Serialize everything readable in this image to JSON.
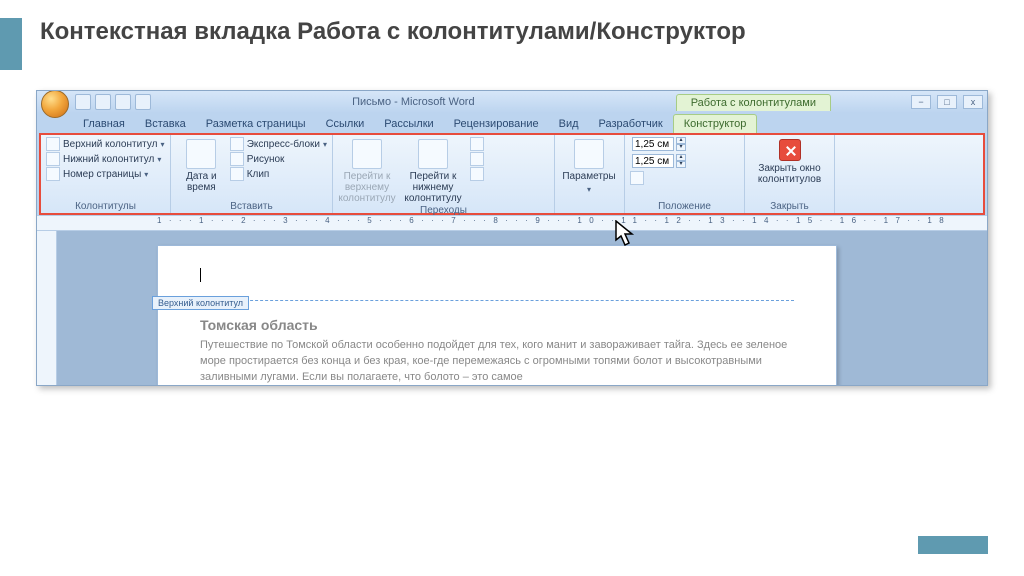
{
  "slide": {
    "title": "Контекстная вкладка Работа с колонтитулами/Конструктор"
  },
  "window": {
    "title": "Письмо - Microsoft Word",
    "context_title": "Работа с колонтитулами",
    "controls": {
      "min": "−",
      "max": "□",
      "close": "x"
    }
  },
  "tabs": {
    "items": [
      "Главная",
      "Вставка",
      "Разметка страницы",
      "Ссылки",
      "Рассылки",
      "Рецензирование",
      "Вид",
      "Разработчик"
    ],
    "active": "Конструктор"
  },
  "ribbon": {
    "group_kolont": {
      "label": "Колонтитулы",
      "top": "Верхний колонтитул",
      "mid": "Нижний колонтитул",
      "bot": "Номер страницы"
    },
    "group_insert": {
      "label": "Вставить",
      "date": "Дата и время",
      "express": "Экспресс-блоки",
      "pic": "Рисунок",
      "clip": "Клип"
    },
    "group_nav": {
      "label": "Переходы",
      "prev": "Перейти к верхнему колонтитулу",
      "next": "Перейти к нижнему колонтитулу"
    },
    "group_params": {
      "label": "",
      "btn": "Параметры"
    },
    "group_pos": {
      "label": "Положение",
      "top_val": "1,25 см",
      "bot_val": "1,25 см"
    },
    "group_close": {
      "label": "Закрыть",
      "btn": "Закрыть окно колонтитулов"
    }
  },
  "ruler": "1···1···2···3···4···5···6···7···8···9···10··11··12··13··14··15··16··17··18",
  "document": {
    "header_tag": "Верхний колонтитул",
    "heading": "Томская область",
    "body": "Путешествие по Томской области особенно подойдет для тех, кого манит и завораживает тайга. Здесь ее зеленое море простирается без конца и без края, кое-где перемежаясь с огромными топями болот и высокотравными заливными лугами. Если вы полагаете, что болото – это самое"
  }
}
